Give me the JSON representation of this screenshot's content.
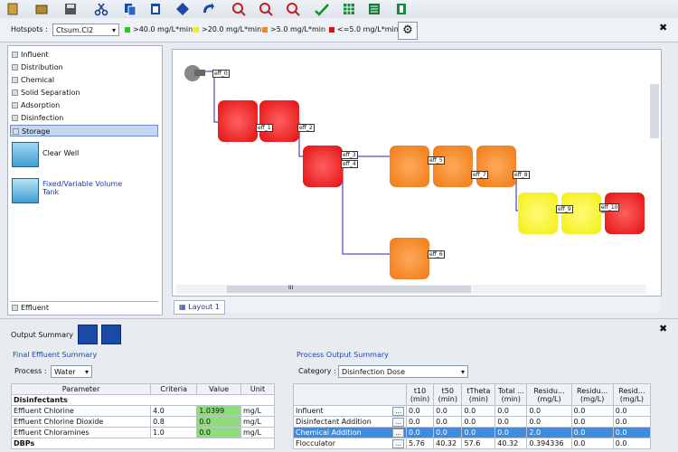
{
  "hotspots": {
    "label": "Hotspots :",
    "selected": "Ctsum.Cl2",
    "legend": [
      {
        "text": ">40.0 mg/L*min",
        "color": "#22cc22"
      },
      {
        "text": ">20.0 mg/L*min",
        "color": "#eeee22"
      },
      {
        "text": ">5.0 mg/L*min",
        "color": "#f08a20"
      },
      {
        "text": "<=5.0 mg/L*min",
        "color": "#e01010"
      }
    ]
  },
  "categories": [
    "Influent",
    "Distribution",
    "Chemical",
    "Solid Separation",
    "Adsorption",
    "Disinfection",
    "Storage",
    "Effluent"
  ],
  "storage_items": [
    "Clear Well",
    "Fixed/Variable Volume Tank"
  ],
  "canvas": {
    "labels": [
      "eff_0",
      "eff_1",
      "eff_2",
      "eff_3",
      "eff_4",
      "eff_5",
      "eff_6",
      "eff_7",
      "eff_8",
      "eff_9",
      "eff_10"
    ],
    "scroll_grip": "III",
    "tab": "Layout 1"
  },
  "output": {
    "title": "Output Summary",
    "final_title": "Final Effluent Summary",
    "process_label": "Process :",
    "process_value": "Water",
    "final_headers": [
      "Parameter",
      "Criteria",
      "Value",
      "Unit"
    ],
    "final_rows": [
      {
        "section": "Disinfectants"
      },
      {
        "param": "Effluent Chlorine",
        "criteria": "4.0",
        "value": "1.0399",
        "unit": "mg/L",
        "highlight": true
      },
      {
        "param": "Effluent Chlorine Dioxide",
        "criteria": "0.8",
        "value": "0.0",
        "unit": "mg/L",
        "highlight": true
      },
      {
        "param": "Effluent Chloramines",
        "criteria": "1.0",
        "value": "0.0",
        "unit": "mg/L",
        "highlight": true
      },
      {
        "section": "DBPs"
      }
    ],
    "pos_title": "Process Output Summary",
    "category_label": "Category :",
    "category_value": "Disinfection Dose",
    "pos_headers": [
      "",
      "t10 (min)",
      "t50 (min)",
      "tTheta (min)",
      "Total ... (min)",
      "Residu... (mg/L)",
      "Residu... (mg/L)",
      "Resid... (mg/L)"
    ],
    "pos_rows": [
      {
        "name": "Influent",
        "vals": [
          "0.0",
          "0.0",
          "0.0",
          "0.0",
          "0.0",
          "0.0",
          "0.0"
        ],
        "selected": false
      },
      {
        "name": "Disinfectant Addition",
        "vals": [
          "0.0",
          "0.0",
          "0.0",
          "0.0",
          "0.0",
          "0.0",
          "0.0"
        ],
        "selected": false
      },
      {
        "name": "Chemical Addition",
        "vals": [
          "0.0",
          "0.0",
          "0.0",
          "0.0",
          "2.0",
          "0.0",
          "0.0"
        ],
        "selected": true
      },
      {
        "name": "Flocculator",
        "vals": [
          "5.76",
          "40.32",
          "57.6",
          "40.32",
          "0.394336",
          "0.0",
          "0.0"
        ],
        "selected": false
      }
    ],
    "dots": "..."
  }
}
